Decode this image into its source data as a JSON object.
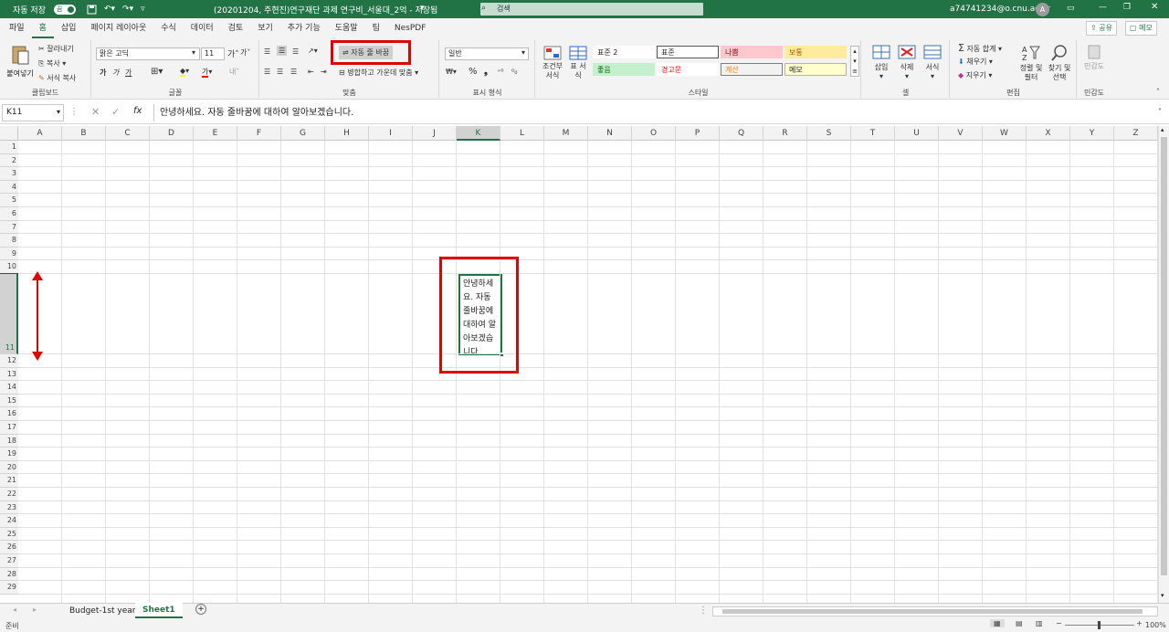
{
  "titlebar": {
    "autosave_label": "자동 저장",
    "autosave_state": "끔",
    "title": "(20201204, 주현진)연구재단 과제 연구비_서울대_2억 - 저장됨",
    "search_placeholder": "검색",
    "user": "a74741234@o.cnu.ac.kr",
    "avatar": "A"
  },
  "tabs": [
    "파일",
    "홈",
    "삽입",
    "페이지 레이아웃",
    "수식",
    "데이터",
    "검토",
    "보기",
    "추가 기능",
    "도움말",
    "팀",
    "NesPDF"
  ],
  "share": "공유",
  "memo": "메모",
  "ribbon": {
    "clipboard": {
      "paste": "붙여넣기",
      "cut": "잘라내기",
      "copy": "복사",
      "format_painter": "서식 복사",
      "label": "클립보드"
    },
    "font": {
      "name": "맑은 고딕",
      "size": "11",
      "bold": "가",
      "italic": "가",
      "underline": "가",
      "label": "글꼴",
      "color_letter": "가"
    },
    "align": {
      "wrap": "자동 줄 바꿈",
      "merge": "병합하고 가운데 맞춤",
      "label": "맞춤"
    },
    "number": {
      "format": "일반",
      "label": "표시 형식"
    },
    "styles": {
      "cond": "조건부 서식",
      "table": "표 서식",
      "s1": "표준 2",
      "s2": "표준",
      "s3": "나쁨",
      "s4": "보통",
      "s5": "좋음",
      "s6": "경고문",
      "s7": "계산",
      "s8": "메모",
      "label": "스타일"
    },
    "cells": {
      "insert": "삽입",
      "delete": "삭제",
      "format": "서식",
      "label": "셀"
    },
    "edit": {
      "autosum": "자동 합계",
      "fill": "채우기",
      "clear": "지우기",
      "sort": "정렬 및 필터",
      "find": "찾기 및 선택",
      "label": "편집"
    },
    "sens": {
      "btn": "민감도",
      "label": "민감도"
    }
  },
  "formula": {
    "namebox": "K11",
    "content": "안녕하세요. 자동 줄바꿈에 대하여 알아보겠습니다."
  },
  "columns": [
    "A",
    "B",
    "C",
    "D",
    "E",
    "F",
    "G",
    "H",
    "I",
    "J",
    "K",
    "L",
    "M",
    "N",
    "O",
    "P",
    "Q",
    "R",
    "S",
    "T",
    "U",
    "V",
    "W",
    "X",
    "Y",
    "Z"
  ],
  "rows": [
    "1",
    "2",
    "3",
    "4",
    "5",
    "6",
    "7",
    "8",
    "9",
    "10",
    "11",
    "12",
    "13",
    "14",
    "15",
    "16",
    "17",
    "18",
    "19",
    "20",
    "21",
    "22",
    "23",
    "24",
    "25",
    "26",
    "27",
    "28",
    "29"
  ],
  "cell_k11": "안녕하세\n요. 자동\n줄바꿈에\n대하여 알\n아보겠습\n니다.",
  "sheets": [
    "Budget-1st year",
    "Sheet1"
  ],
  "status": {
    "ready": "준비",
    "zoom": "100%"
  }
}
